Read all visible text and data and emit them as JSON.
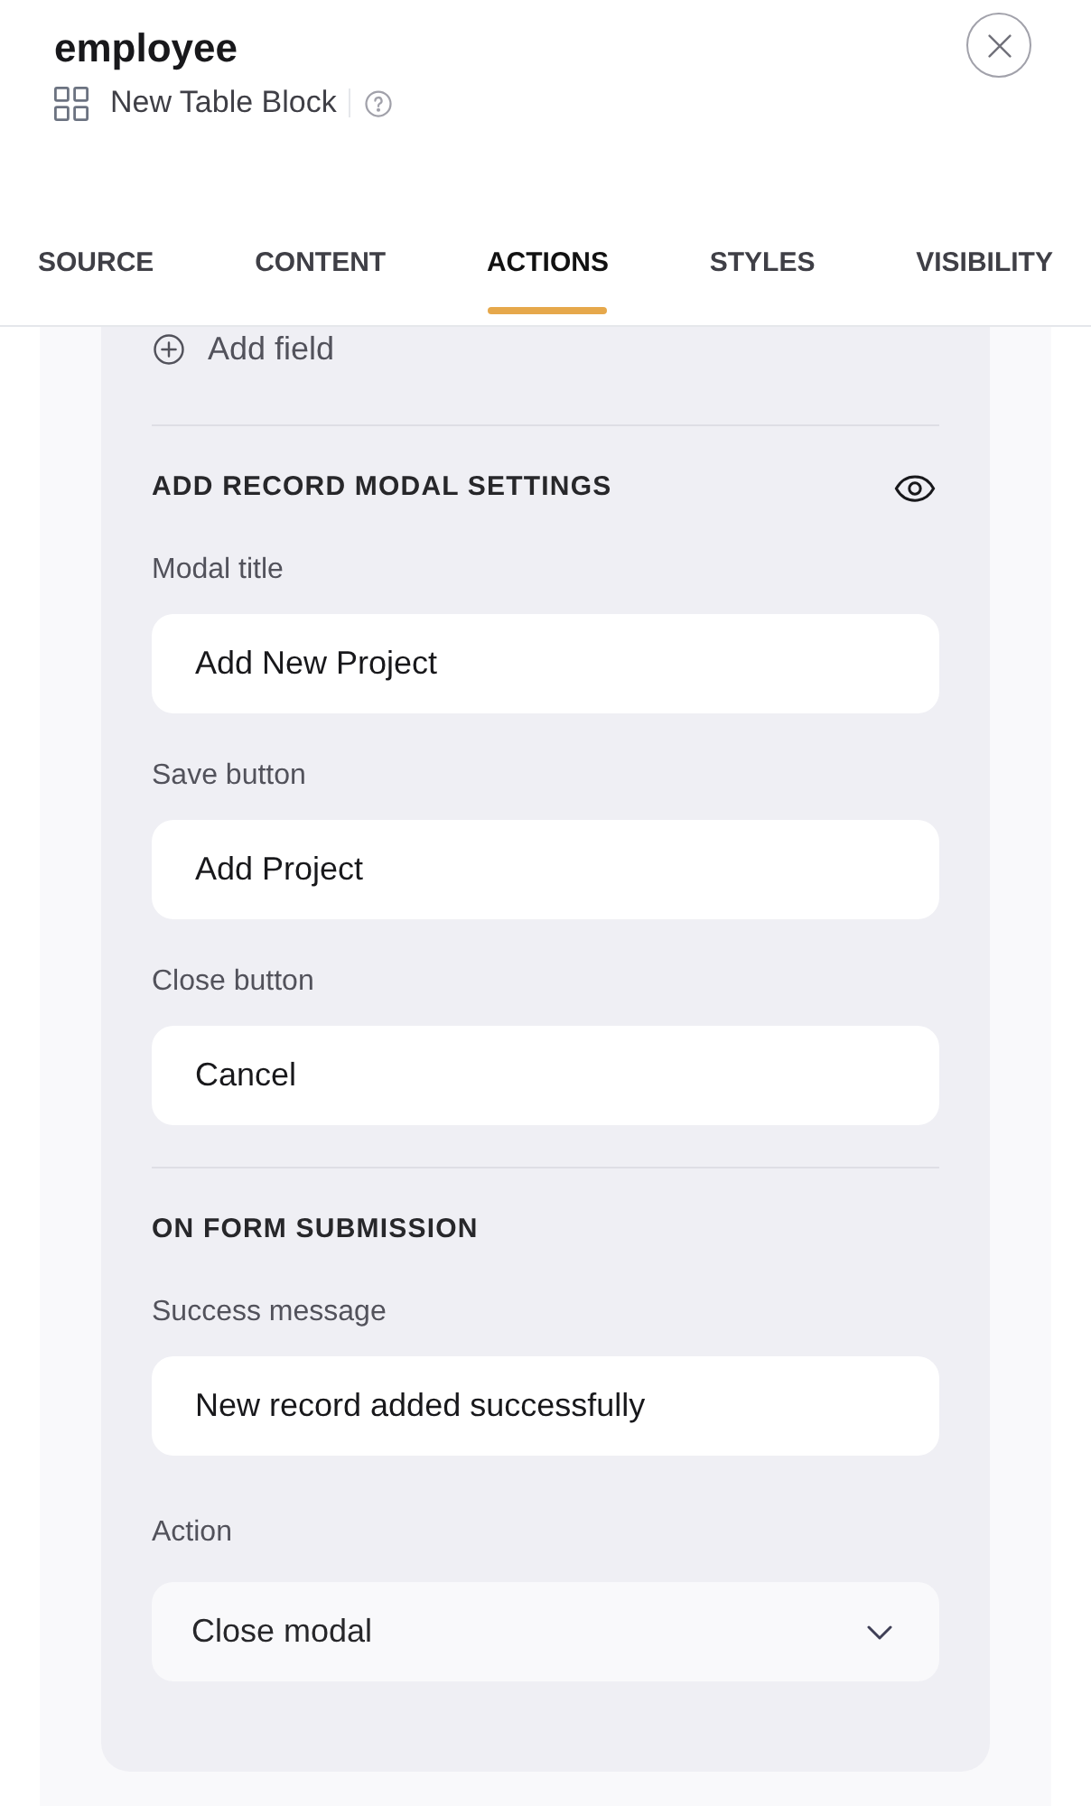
{
  "header": {
    "title": "employee",
    "subtitle": "New Table Block"
  },
  "tabs": [
    {
      "label": "SOURCE",
      "selected": false
    },
    {
      "label": "CONTENT",
      "selected": false
    },
    {
      "label": "ACTIONS",
      "selected": true
    },
    {
      "label": "STYLES",
      "selected": false
    },
    {
      "label": "VISIBILITY",
      "selected": false
    }
  ],
  "add_field": {
    "label": "Add field"
  },
  "sections": [
    {
      "heading": "ADD RECORD MODAL SETTINGS",
      "preview": true,
      "fields": [
        {
          "kind": "text",
          "label": "Modal title",
          "value": "Add New Project"
        },
        {
          "kind": "text",
          "label": "Save button",
          "value": "Add Project"
        },
        {
          "kind": "text",
          "label": "Close button",
          "value": "Cancel"
        }
      ]
    },
    {
      "heading": "ON FORM SUBMISSION",
      "preview": false,
      "fields": [
        {
          "kind": "text",
          "label": "Success message",
          "value": "New record added successfully"
        },
        {
          "kind": "select",
          "label": "Action",
          "value": "Close modal"
        }
      ]
    }
  ]
}
